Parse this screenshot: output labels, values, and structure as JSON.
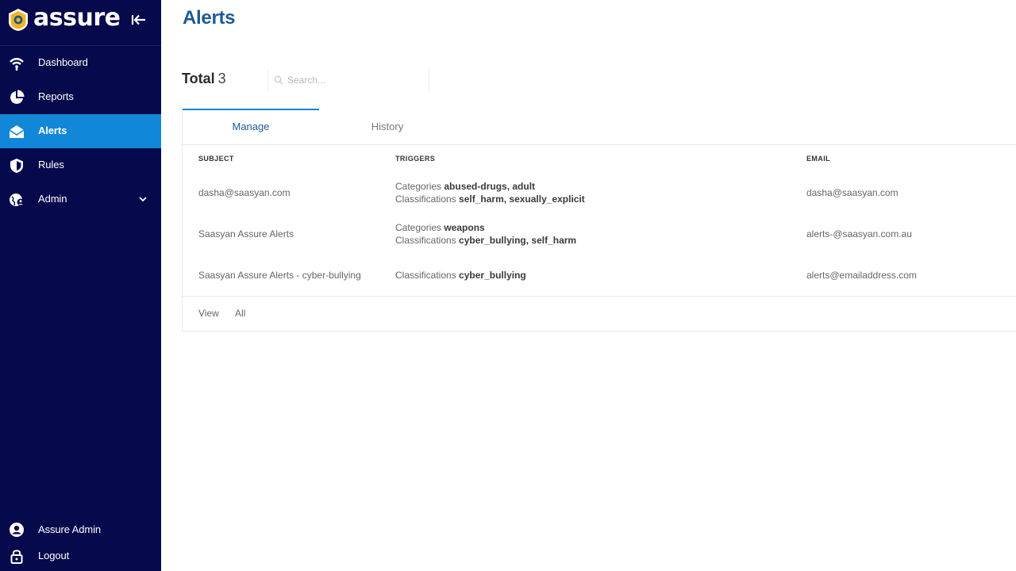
{
  "app": {
    "brand": "assure",
    "brand_color": "#06094b",
    "accent": "#1187d8",
    "logo_icon": "shield-logo-icon"
  },
  "sidebar": {
    "collapse_icon": "collapse-left-icon",
    "items": [
      {
        "label": "Dashboard",
        "icon": "wifi-icon",
        "active": false
      },
      {
        "label": "Reports",
        "icon": "pie-chart-icon",
        "active": false
      },
      {
        "label": "Alerts",
        "icon": "envelope-open-icon",
        "active": true
      },
      {
        "label": "Rules",
        "icon": "shield-icon",
        "active": false
      },
      {
        "label": "Admin",
        "icon": "globe-user-icon",
        "active": false,
        "expandable": true
      }
    ],
    "user": {
      "label": "Assure Admin",
      "icon": "user-circle-icon"
    },
    "logout": {
      "label": "Logout",
      "icon": "lock-icon"
    }
  },
  "page": {
    "title": "Alerts"
  },
  "summary": {
    "total_label": "Total",
    "total_count": "3"
  },
  "search": {
    "placeholder": "Search...",
    "value": ""
  },
  "tabs": [
    {
      "label": "Manage",
      "active": true
    },
    {
      "label": "History",
      "active": false
    }
  ],
  "table": {
    "headers": {
      "subject": "SUBJECT",
      "triggers": "TRIGGERS",
      "email": "EMAIL"
    },
    "rows": [
      {
        "subject": "dasha@saasyan.com",
        "triggers": [
          {
            "key": "Categories",
            "value": "abused-drugs, adult"
          },
          {
            "key": "Classifications",
            "value": "self_harm, sexually_explicit"
          }
        ],
        "email": "dasha@saasyan.com"
      },
      {
        "subject": "Saasyan Assure Alerts",
        "triggers": [
          {
            "key": "Categories",
            "value": "weapons"
          },
          {
            "key": "Classifications",
            "value": "cyber_bullying, self_harm"
          }
        ],
        "email": "alerts-@saasyan.com.au"
      },
      {
        "subject": "Saasyan Assure Alerts - cyber-bullying",
        "triggers": [
          {
            "key": "Classifications",
            "value": "cyber_bullying"
          }
        ],
        "email": "alerts@emailaddress.com"
      }
    ]
  },
  "footer": {
    "view_label": "View",
    "view_value": "All"
  }
}
